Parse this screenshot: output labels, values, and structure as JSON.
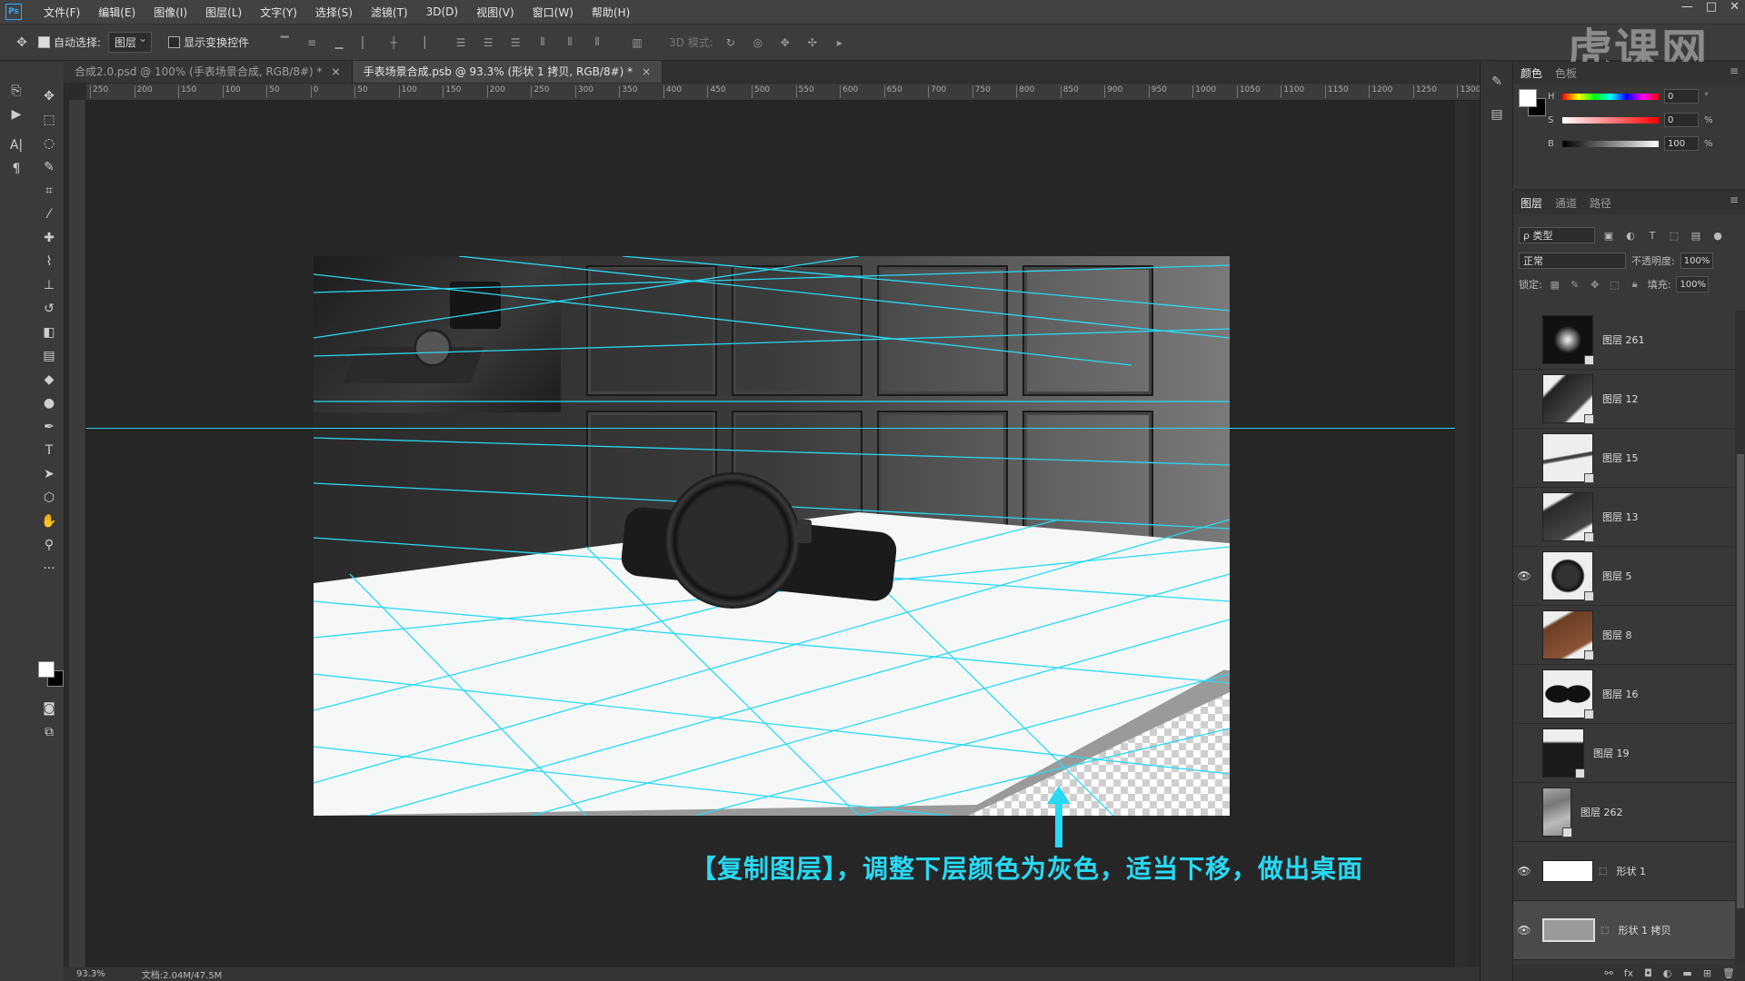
{
  "menubar": {
    "logo": "Ps",
    "items": [
      "文件(F)",
      "编辑(E)",
      "图像(I)",
      "图层(L)",
      "文字(Y)",
      "选择(S)",
      "滤镜(T)",
      "3D(D)",
      "视图(V)",
      "窗口(W)",
      "帮助(H)"
    ],
    "window_controls": [
      "—",
      "□",
      "✕"
    ]
  },
  "options": {
    "auto_select_label": "自动选择:",
    "auto_select_target": "图层",
    "show_transform_label": "显示变换控件",
    "mode3d_label": "3D 模式:"
  },
  "watermark": "虎课网",
  "tabs": [
    {
      "title": "合成2.0.psd @ 100% (手表场景合成, RGB/8#) *",
      "active": false
    },
    {
      "title": "手表场景合成.psb @ 93.3% (形状 1 拷贝, RGB/8#) *",
      "active": true
    }
  ],
  "ruler": {
    "h_ticks": [
      "250",
      "200",
      "150",
      "100",
      "50",
      "0",
      "50",
      "100",
      "150",
      "200",
      "250",
      "300",
      "350",
      "400",
      "450",
      "500",
      "550",
      "600",
      "650",
      "700",
      "750",
      "800",
      "850",
      "900",
      "950",
      "1000",
      "1050",
      "1100",
      "1150",
      "1200",
      "1250",
      "1300"
    ]
  },
  "status": {
    "zoom": "93.3%",
    "doc": "文档:2.04M/47.5M"
  },
  "caption": "【复制图层】，调整下层颜色为灰色，适当下移，做出桌面",
  "color_panel": {
    "tabs": [
      "颜色",
      "色板"
    ],
    "h": {
      "label": "H",
      "value": "0",
      "unit": "°"
    },
    "s": {
      "label": "S",
      "value": "0",
      "unit": "%"
    },
    "b": {
      "label": "B",
      "value": "100",
      "unit": "%"
    }
  },
  "layers_panel": {
    "tabs": [
      "图层",
      "通道",
      "路径"
    ],
    "filter": "ρ 类型",
    "blend_mode": "正常",
    "opacity_label": "不透明度:",
    "opacity": "100%",
    "lock_label": "锁定:",
    "fill_label": "填充:",
    "fill": "100%",
    "layers": [
      {
        "name": "图层 261",
        "visible": false,
        "selected": false
      },
      {
        "name": "图层 12",
        "visible": false,
        "selected": false
      },
      {
        "name": "图层 15",
        "visible": false,
        "selected": false
      },
      {
        "name": "图层 13",
        "visible": false,
        "selected": false
      },
      {
        "name": "图层 5",
        "visible": true,
        "selected": false
      },
      {
        "name": "图层 8",
        "visible": false,
        "selected": false
      },
      {
        "name": "图层 16",
        "visible": false,
        "selected": false
      },
      {
        "name": "图层 19",
        "visible": false,
        "selected": false
      },
      {
        "name": "图层 262",
        "visible": false,
        "selected": false
      },
      {
        "name": "形状 1",
        "visible": true,
        "selected": false
      },
      {
        "name": "形状 1 拷贝",
        "visible": true,
        "selected": true
      }
    ],
    "footer_icons": [
      "link-icon",
      "fx-icon",
      "mask-icon",
      "adjustment-icon",
      "folder-icon",
      "new-layer-icon",
      "trash-icon"
    ]
  },
  "colors": {
    "guide_cyan": "#29d9f4",
    "caption_cyan": "#29d9f4",
    "accent_blue": "#31a8ff"
  }
}
